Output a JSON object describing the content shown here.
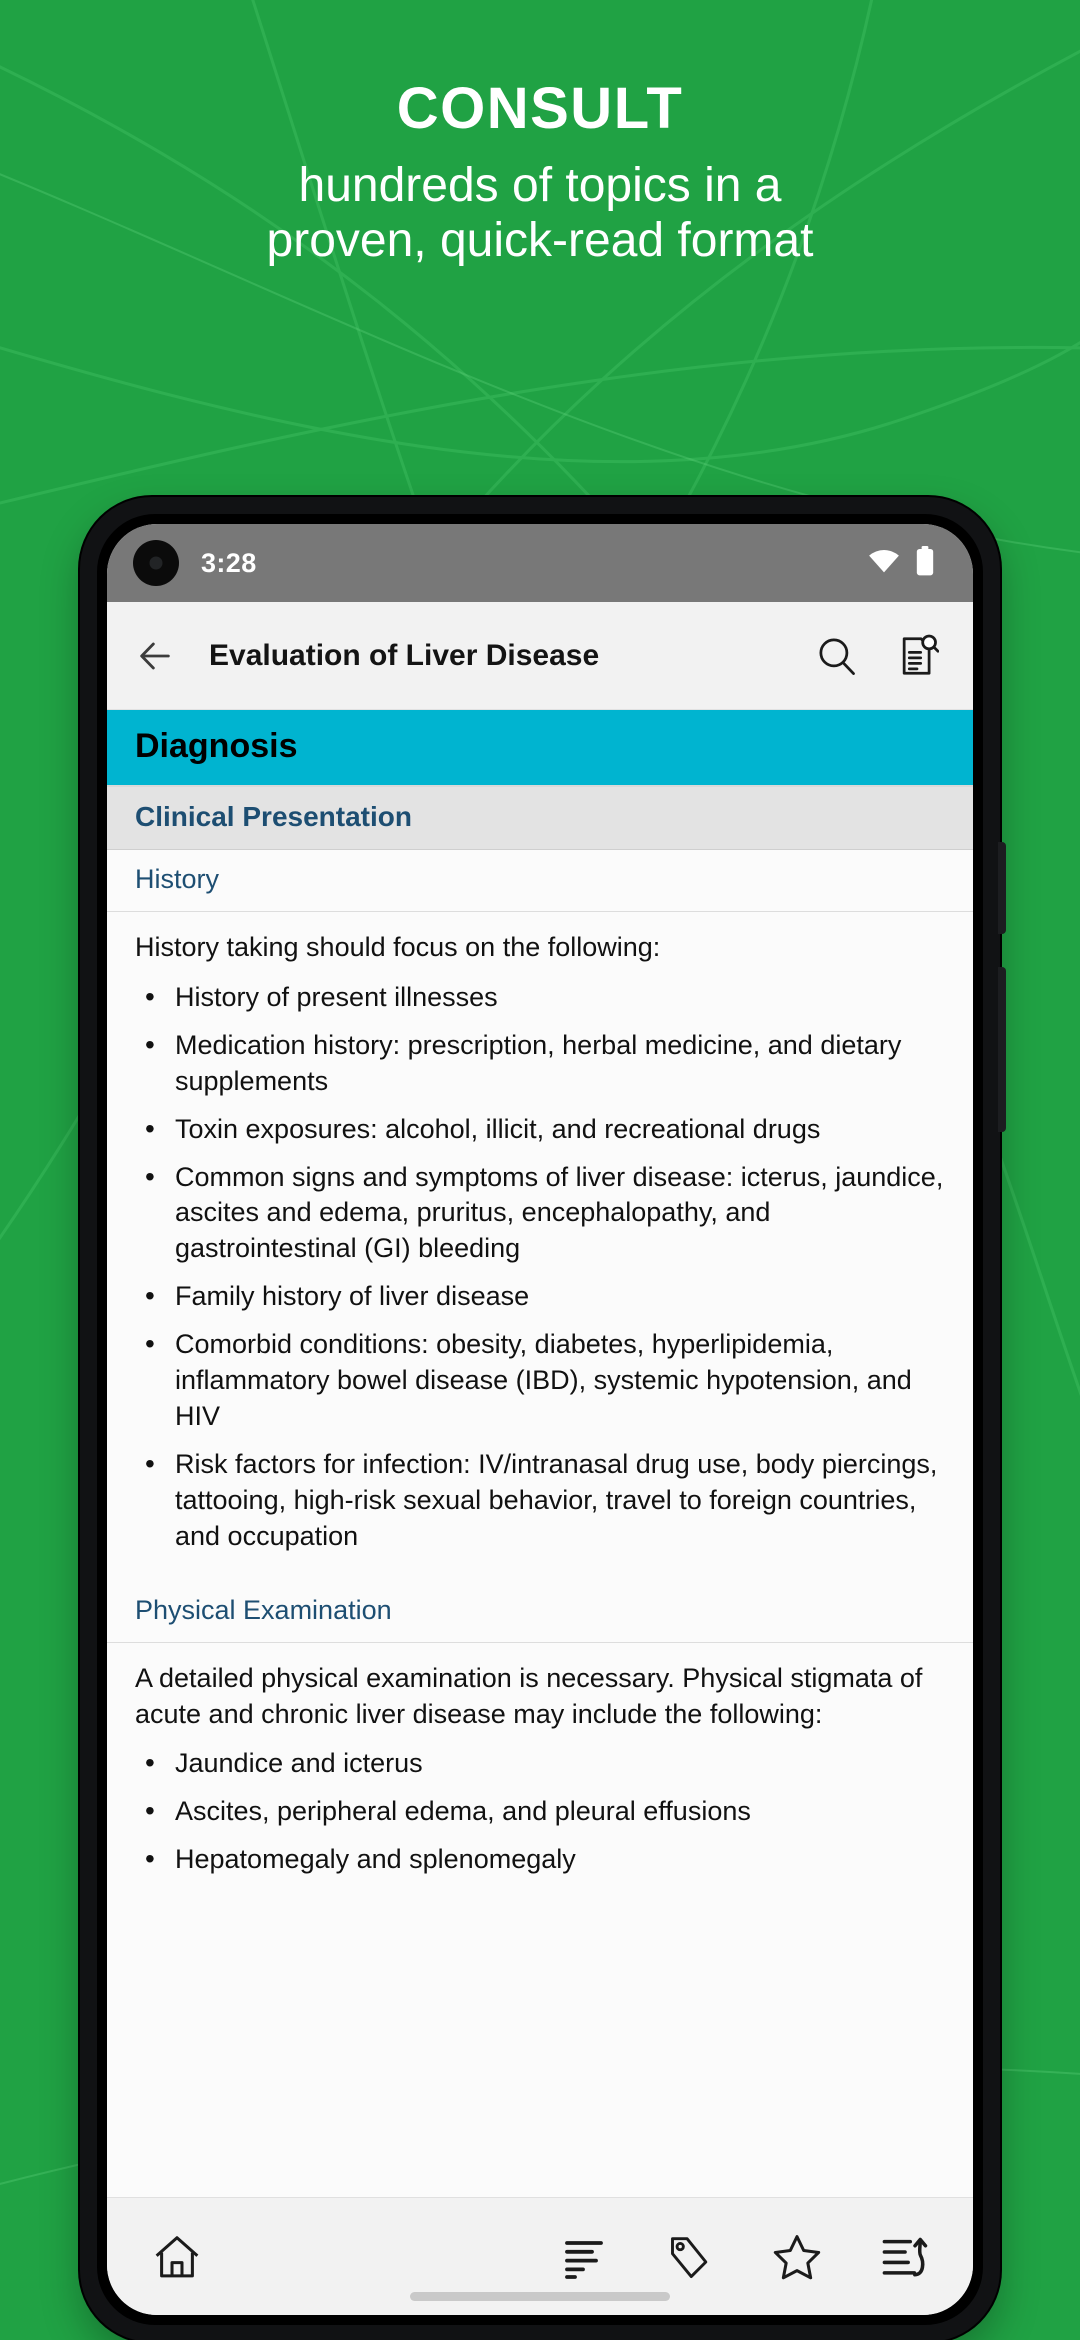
{
  "promo": {
    "title": "CONSULT",
    "subtitle_line1": "hundreds of topics in a",
    "subtitle_line2": "proven, quick-read format",
    "background_color": "#20a244",
    "text_color": "#ffffff"
  },
  "phone": {
    "statusbar": {
      "time": "3:28",
      "background_color": "#787878",
      "icons": [
        "wifi-icon",
        "battery-icon"
      ]
    },
    "appbar": {
      "back_icon": "back-arrow-icon",
      "title": "Evaluation of Liver Disease",
      "actions": [
        "search-icon",
        "document-search-icon"
      ]
    },
    "content": {
      "chapter_banner": {
        "label": "Diagnosis",
        "background_color": "#00b4d0",
        "text_color": "#000000"
      },
      "section_header": {
        "label": "Clinical Presentation",
        "background_color": "#e3e3e3",
        "text_color": "#1d4e72"
      },
      "blocks": [
        {
          "sub_head": "History",
          "paragraph": "History taking should focus on the following:",
          "bullets": [
            "History of present illnesses",
            "Medication history: prescription, herbal medicine, and dietary supplements",
            "Toxin exposures: alcohol, illicit, and recreational drugs",
            "Common signs and symptoms of liver disease: icterus, jaundice, ascites and edema, pruritus, encephalopathy, and gastrointestinal (GI) bleeding",
            "Family history of liver disease",
            "Comorbid conditions: obesity, diabetes, hyperlipidemia, inflammatory bowel disease (IBD), systemic hypotension, and HIV",
            "Risk factors for infection: IV/intranasal drug use, body piercings, tattooing, high-risk sexual behavior, travel to foreign countries, and occupation"
          ]
        },
        {
          "sub_head": "Physical Examination",
          "paragraph": "A detailed physical examination is necessary. Physical stigmata of acute and chronic liver disease may include the following:",
          "bullets": [
            "Jaundice and icterus",
            "Ascites, peripheral edema, and pleural effusions",
            "Hepatomegaly and splenomegaly"
          ]
        }
      ]
    },
    "bottom_nav": {
      "items": [
        {
          "name": "home",
          "icon": "home-icon"
        },
        {
          "name": "outline",
          "icon": "outline-list-icon"
        },
        {
          "name": "tags",
          "icon": "tag-icon"
        },
        {
          "name": "favorites",
          "icon": "star-icon"
        },
        {
          "name": "jump-to-section",
          "icon": "jump-to-section-icon"
        }
      ]
    }
  }
}
